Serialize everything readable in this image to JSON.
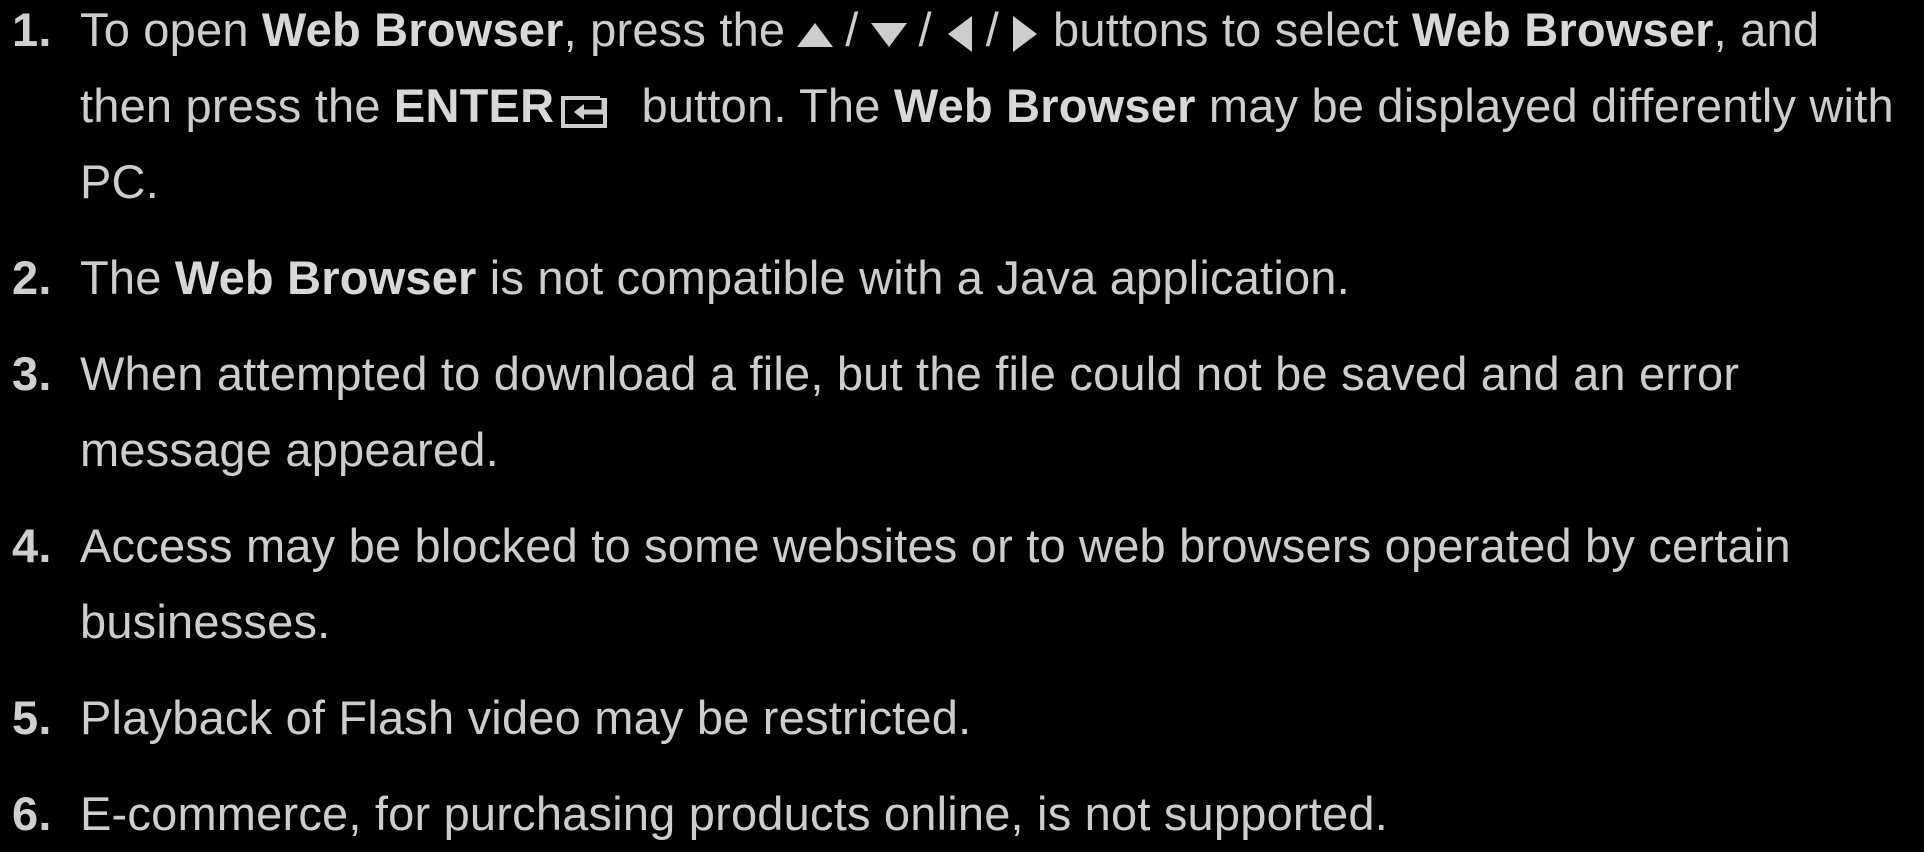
{
  "colors": {
    "background": "#000000",
    "text": "#cdcdcd",
    "bold_text": "#d8d8d8"
  },
  "items": [
    {
      "number": "1.",
      "segments": {
        "s0": "To open ",
        "s1": "Web Browser",
        "s2": ", press the",
        "sep1": "/",
        "sep2": "/",
        "sep3": "/",
        "s3": "buttons to select ",
        "s4": "Web Browser",
        "s5": ", and then press the ",
        "s6": "ENTER",
        "s7": " button. The ",
        "s8": "Web Browser",
        "s9": " may be displayed differently with PC."
      },
      "icons": [
        "up-arrow-icon",
        "down-arrow-icon",
        "left-arrow-icon",
        "right-arrow-icon",
        "enter-icon"
      ]
    },
    {
      "number": "2.",
      "segments": {
        "s0": "The ",
        "s1": "Web Browser",
        "s2": " is not compatible with a Java application."
      }
    },
    {
      "number": "3.",
      "segments": {
        "s0": "When attempted to download a file, but the file could not be saved and an error message appeared."
      }
    },
    {
      "number": "4.",
      "segments": {
        "s0": "Access may be blocked to some websites or to web browsers operated by certain businesses."
      }
    },
    {
      "number": "5.",
      "segments": {
        "s0": "Playback of Flash video may be restricted."
      }
    },
    {
      "number": "6.",
      "segments": {
        "s0": "E-commerce, for purchasing products online, is not supported."
      }
    }
  ]
}
